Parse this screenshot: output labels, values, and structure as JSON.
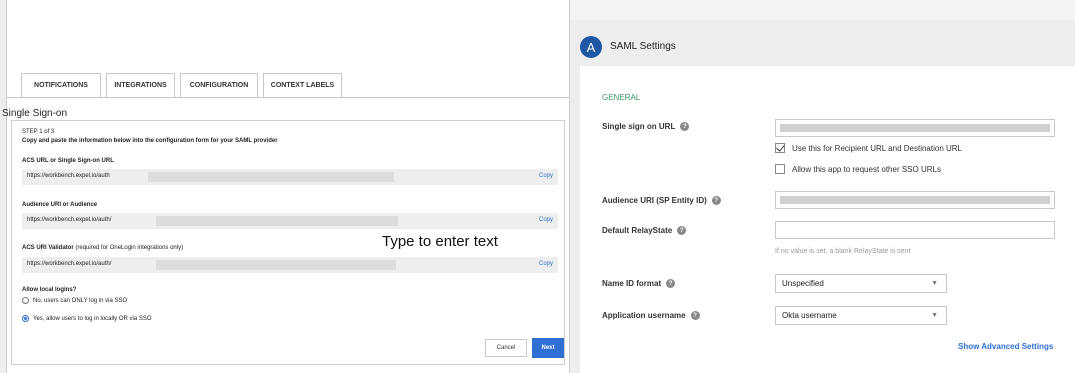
{
  "tabs": [
    {
      "label": "NOTIFICATIONS"
    },
    {
      "label": "INTEGRATIONS"
    },
    {
      "label": "CONFIGURATION"
    },
    {
      "label": "CONTEXT LABELS"
    }
  ],
  "sso": {
    "title": "Single Sign-on",
    "step": "STEP 1 of 3",
    "instructions": "Copy and paste the information below into the configuration form for your SAML provider",
    "acs_label": "ACS URL or Single Sign-on URL",
    "acs_value": "https://workbench.expel.io/auth",
    "audience_label": "Audience URI or Audience",
    "audience_value": "https://workbench.expel.io/auth/",
    "validator_label": "ACS URI Validator",
    "validator_note": "(required for OneLogin integrations only)",
    "validator_value": "https://workbench.expel.io/auth/",
    "copy_label": "Copy",
    "allow_label": "Allow local logins?",
    "radio_no": "No, users can ONLY log in via SSO",
    "radio_yes": "Yes, allow users to log in locally OR via SSO",
    "cancel_label": "Cancel",
    "next_label": "Next"
  },
  "overlay_text": "Type to enter text",
  "saml": {
    "icon_letter": "A",
    "title": "SAML Settings",
    "section": "GENERAL",
    "sso_url_label": "Single sign on URL",
    "recipient_check": "Use this for Recipient URL and Destination URL",
    "other_sso_check": "Allow this app to request other SSO URLs",
    "audience_label": "Audience URI (SP Entity ID)",
    "relay_label": "Default RelayState",
    "relay_hint": "If no value is set, a blank RelayState is sent",
    "nameid_label": "Name ID format",
    "nameid_value": "Unspecified",
    "username_label": "Application username",
    "username_value": "Okta username",
    "advanced_link": "Show Advanced Settings"
  },
  "colors": {
    "accent": "#2f6fd4",
    "section_green": "#3c9a63",
    "brand_blue": "#1f57a5"
  }
}
